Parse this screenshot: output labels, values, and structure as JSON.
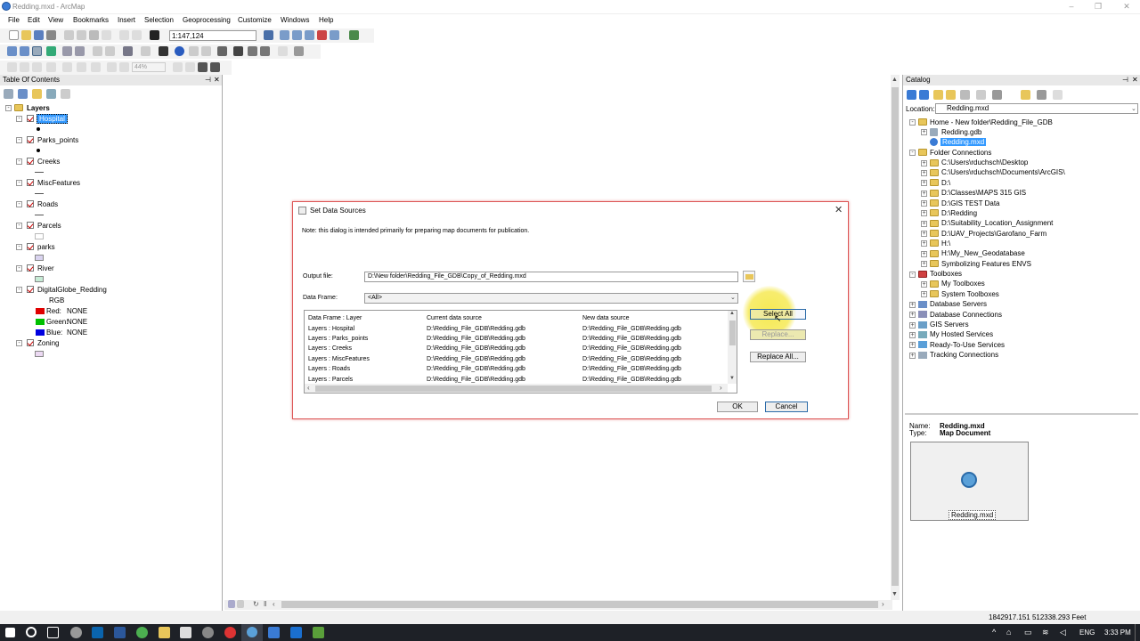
{
  "window": {
    "title": "Redding.mxd - ArcMap"
  },
  "menubar": [
    "File",
    "Edit",
    "View",
    "Bookmarks",
    "Insert",
    "Selection",
    "Geoprocessing",
    "Customize",
    "Windows",
    "Help"
  ],
  "toolbar": {
    "scale": "1:147,124",
    "zoom_pct": "44%"
  },
  "toc": {
    "title": "Table Of Contents",
    "root": "Layers",
    "layers": [
      {
        "name": "Hospital"
      },
      {
        "name": "Parks_points"
      },
      {
        "name": "Creeks"
      },
      {
        "name": "MiscFeatures"
      },
      {
        "name": "Roads"
      },
      {
        "name": "Parcels"
      },
      {
        "name": "parks"
      },
      {
        "name": "River"
      },
      {
        "name": "DigitalGlobe_Redding"
      },
      {
        "name": "Zoning"
      }
    ],
    "raster": {
      "rgb": "RGB",
      "red": "Red:",
      "red_val": "NONE",
      "green": "Green:",
      "green_val": "NONE",
      "blue": "Blue:",
      "blue_val": "NONE"
    }
  },
  "catalog": {
    "title": "Catalog",
    "location_label": "Location:",
    "location": "Redding.mxd",
    "items": [
      {
        "label": "Home - New folder\\Redding_File_GDB"
      },
      {
        "label": "Redding.gdb"
      },
      {
        "label": "Redding.mxd"
      },
      {
        "label": "Folder Connections"
      },
      {
        "label": "C:\\Users\\rduchsch\\Desktop"
      },
      {
        "label": "C:\\Users\\rduchsch\\Documents\\ArcGIS\\"
      },
      {
        "label": "D:\\"
      },
      {
        "label": "D:\\Classes\\MAPS 315 GIS"
      },
      {
        "label": "D:\\GIS TEST Data"
      },
      {
        "label": "D:\\Redding"
      },
      {
        "label": "D:\\Suitability_Location_Assignment"
      },
      {
        "label": "D:\\UAV_Projects\\Garofano_Farm"
      },
      {
        "label": "H:\\"
      },
      {
        "label": "H:\\My_New_Geodatabase"
      },
      {
        "label": "Symbolizing Features ENVS"
      },
      {
        "label": "Toolboxes"
      },
      {
        "label": "My Toolboxes"
      },
      {
        "label": "System Toolboxes"
      },
      {
        "label": "Database Servers"
      },
      {
        "label": "Database Connections"
      },
      {
        "label": "GIS Servers"
      },
      {
        "label": "My Hosted Services"
      },
      {
        "label": "Ready-To-Use Services"
      },
      {
        "label": "Tracking Connections"
      }
    ],
    "preview": {
      "name_label": "Name:",
      "name": "Redding.mxd",
      "type_label": "Type:",
      "type": "Map Document",
      "thumb_caption": "Redding.mxd"
    }
  },
  "dialog": {
    "title": "Set Data Sources",
    "note": "Note: this dialog is intended primarily for preparing map documents for publication.",
    "output_label": "Output file:",
    "output_value": "D:\\New folder\\Redding_File_GDB\\Copy_of_Redding.mxd",
    "frame_label": "Data Frame:",
    "frame_value": "<All>",
    "columns": [
      "Data Frame : Layer",
      "Current data source",
      "New data source"
    ],
    "rows": [
      [
        "Layers : Hospital",
        "D:\\Redding_File_GDB\\Redding.gdb",
        "D:\\Redding_File_GDB\\Redding.gdb"
      ],
      [
        "Layers : Parks_points",
        "D:\\Redding_File_GDB\\Redding.gdb",
        "D:\\Redding_File_GDB\\Redding.gdb"
      ],
      [
        "Layers : Creeks",
        "D:\\Redding_File_GDB\\Redding.gdb",
        "D:\\Redding_File_GDB\\Redding.gdb"
      ],
      [
        "Layers : MiscFeatures",
        "D:\\Redding_File_GDB\\Redding.gdb",
        "D:\\Redding_File_GDB\\Redding.gdb"
      ],
      [
        "Layers : Roads",
        "D:\\Redding_File_GDB\\Redding.gdb",
        "D:\\Redding_File_GDB\\Redding.gdb"
      ],
      [
        "Layers : Parcels",
        "D:\\Redding_File_GDB\\Redding.gdb",
        "D:\\Redding_File_GDB\\Redding.gdb"
      ]
    ],
    "select_all": "Select All",
    "replace": "Replace...",
    "replace_all": "Replace All...",
    "ok": "OK",
    "cancel": "Cancel"
  },
  "status": {
    "coords": "1842917.151  512338.293 Feet"
  },
  "taskbar": {
    "lang": "ENG",
    "time": "3:33 PM"
  },
  "colors": {
    "highlight": "#3399ff",
    "cursor_halo": "#f5e84a",
    "dialog_border": "#dd5555",
    "red": "#e00000",
    "green": "#00c000",
    "blue": "#0000e0"
  }
}
